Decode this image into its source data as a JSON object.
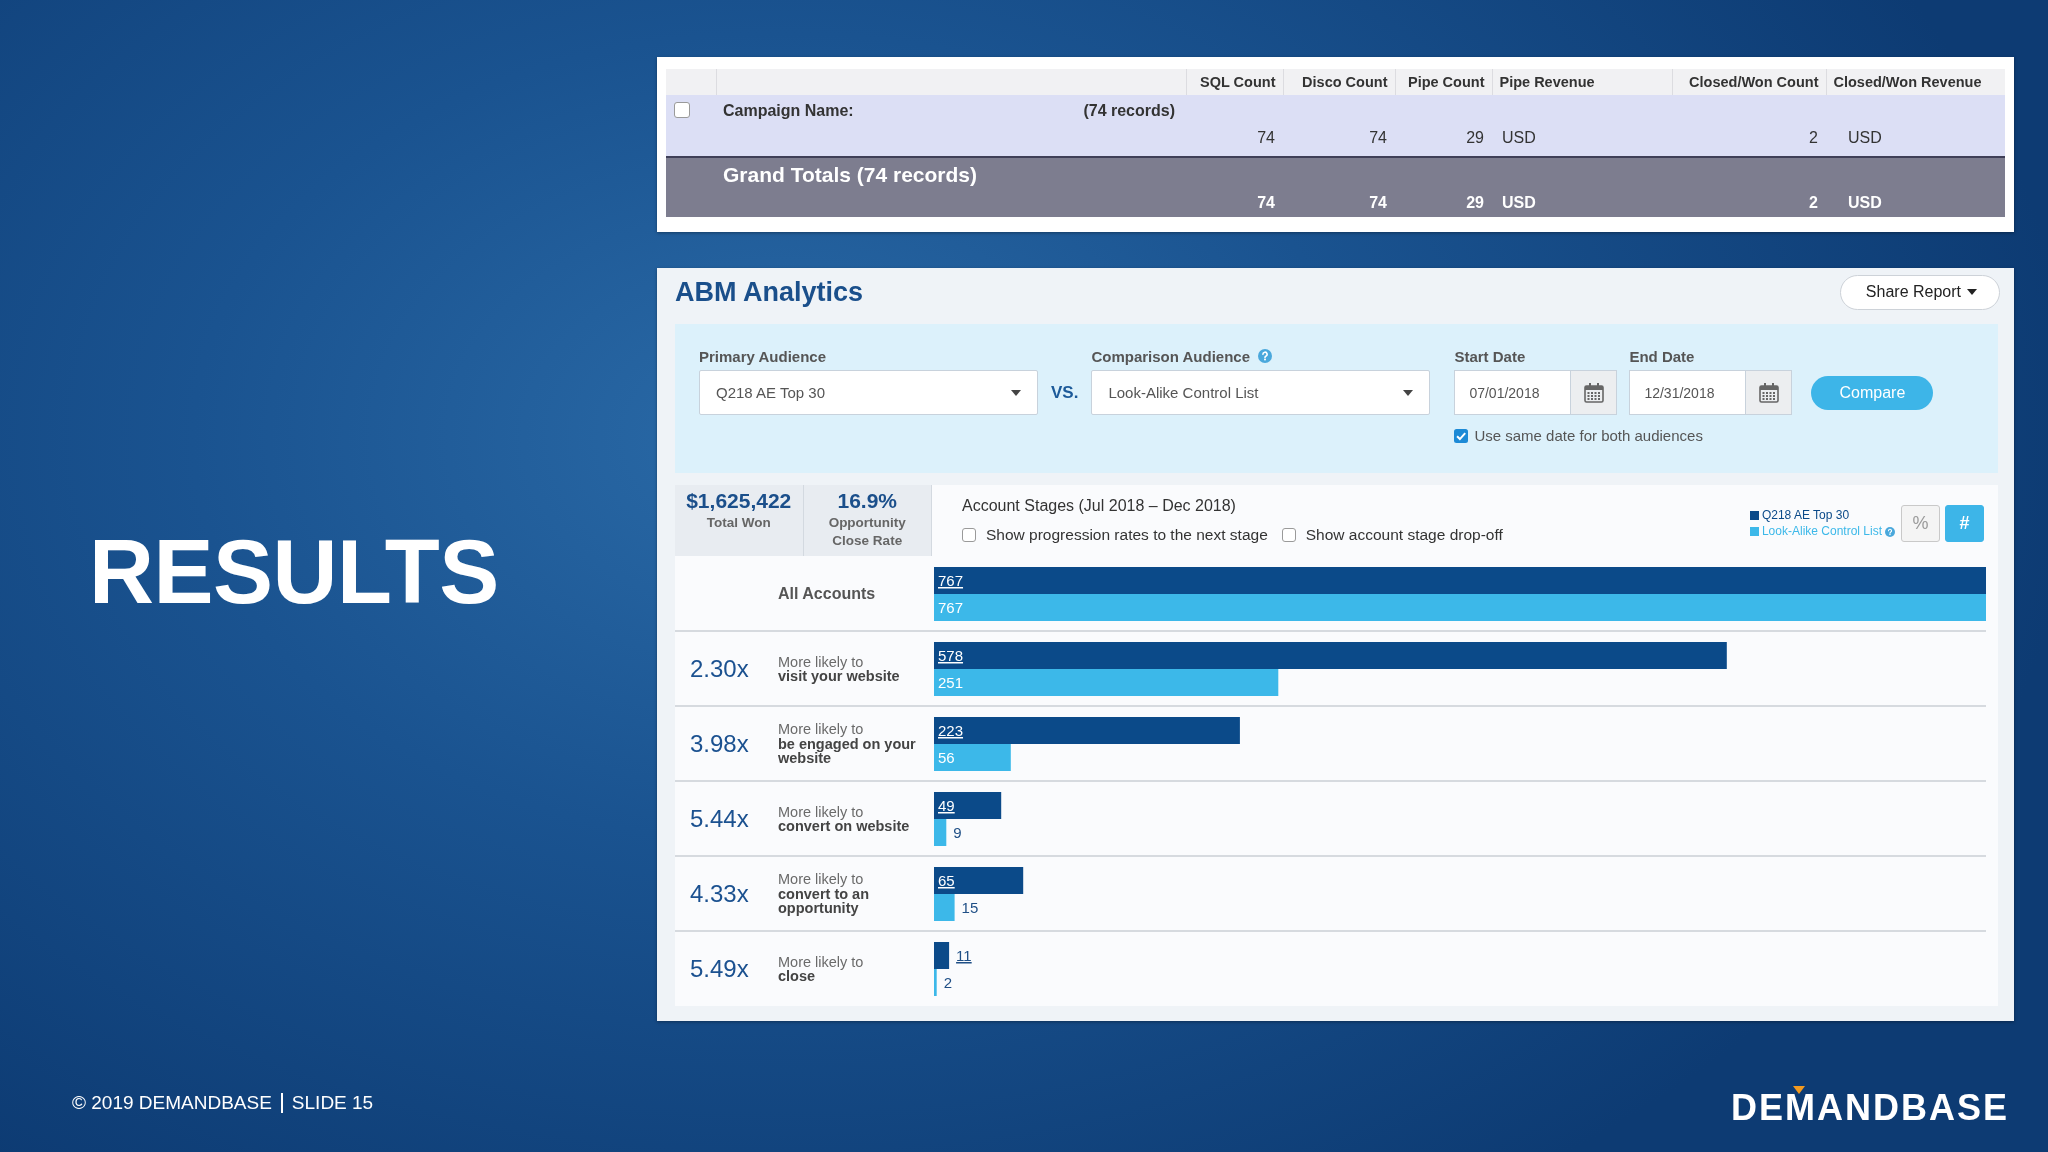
{
  "slide": {
    "title": "RESULTS"
  },
  "report_table": {
    "columns": [
      {
        "label": "SQL Count",
        "kind": "count"
      },
      {
        "label": "Disco Count",
        "kind": "count"
      },
      {
        "label": "Pipe Count",
        "kind": "count"
      },
      {
        "label": "Pipe Revenue",
        "kind": "currency"
      },
      {
        "label": "Closed/Won Count",
        "kind": "count"
      },
      {
        "label": "Closed/Won Revenue",
        "kind": "currency"
      }
    ],
    "rows": [
      {
        "kind": "group",
        "checked": false,
        "label": "Campaign Name:",
        "count": "(74 records)",
        "cells": [
          "74",
          "74",
          "29",
          "USD",
          "2",
          "USD"
        ]
      },
      {
        "kind": "total",
        "label": "Grand Totals (74 records)",
        "cells": [
          "74",
          "74",
          "29",
          "USD",
          "2",
          "USD"
        ]
      }
    ]
  },
  "abm_analytics": {
    "title": "ABM Analytics",
    "share_button": "Share Report",
    "filters": {
      "primary_audience": {
        "label": "Primary Audience",
        "value": "Q218 AE Top 30"
      },
      "separator": "VS.",
      "comparison_audience": {
        "label": "Comparison Audience",
        "value": "Look-Alike Control List"
      },
      "start_date": {
        "label": "Start Date",
        "value": "07/01/2018"
      },
      "end_date": {
        "label": "End Date",
        "value": "12/31/2018"
      },
      "compare_button": "Compare",
      "same_date": {
        "label": "Use same date for both audiences",
        "checked": true
      }
    },
    "stats": [
      {
        "value": "$1,625,422",
        "label": "Total Won"
      },
      {
        "value": "16.9%",
        "label": "Opportunity Close Rate"
      }
    ],
    "account_stages": {
      "options": [
        {
          "label": "Show progression rates to the next stage",
          "checked": false
        },
        {
          "label": "Show account stage drop-off",
          "checked": false
        }
      ],
      "view_toggle": [
        {
          "label": "%",
          "selected": false
        },
        {
          "label": "#",
          "selected": true
        }
      ],
      "multipliers": [
        "2.30x",
        "3.98x",
        "5.44x",
        "4.33x",
        "5.49x"
      ],
      "chart_data": [
        {
          "type": "bar",
          "orientation": "horizontal",
          "title": "Account Stages (Jul 2018 – Dec 2018)",
          "categories": [
            "All Accounts",
            "More likely to **visit your website**",
            "More likely to **be engaged on your website**",
            "More likely to **convert on website**",
            "More likely to **convert to an opportunity**",
            "More likely to **close**"
          ],
          "series": [
            {
              "name": "Q218 AE Top 30",
              "color": "#0b4a89",
              "values": [
                767,
                578,
                223,
                49,
                65,
                11
              ]
            },
            {
              "name": "Look-Alike Control List",
              "color": "#3cb8e9",
              "values": [
                767,
                251,
                56,
                9,
                15,
                2
              ]
            }
          ],
          "data_labels": true,
          "legend": "top-right"
        }
      ]
    }
  },
  "footer": {
    "copyright": "© 2019 DEMANDBASE",
    "slide_number": "SLIDE 15",
    "logo": "DEMANDBASE"
  }
}
